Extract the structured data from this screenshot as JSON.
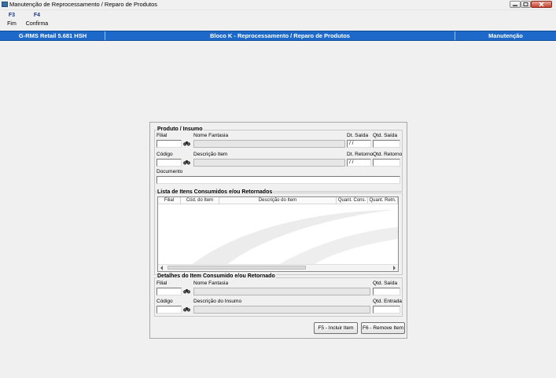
{
  "window": {
    "title": "Manutenção de Reprocessamento / Reparo de Produtos"
  },
  "toolbar": {
    "items": [
      {
        "key": "F3",
        "label": "Fim"
      },
      {
        "key": "F4",
        "label": "Confirma"
      }
    ]
  },
  "statusbar": {
    "app": "G-RMS Retail 5.681 HSH",
    "module": "Bloco K - Reprocessamento / Reparo de Produtos",
    "mode": "Manutenção",
    "color": "#1c69c9"
  },
  "produto_insumo": {
    "title": "Produto / Insumo",
    "filial_label": "Filial",
    "nome_fantasia_label": "Nome Fantasia",
    "dt_saida_label": "Dt. Saída",
    "dt_saida_value": " / /",
    "qtd_saida_label": "Qtd. Saída",
    "codigo_label": "Código",
    "descricao_item_label": "Descrição Item",
    "dt_retorno_label": "Dt. Retorno",
    "dt_retorno_value": " / /",
    "qtd_retorno_label": "Qtd. Retorno",
    "documento_label": "Documento"
  },
  "lista": {
    "title": "Lista de Itens Consumidos e/ou Retornados",
    "columns": [
      "Filial",
      "Cód. do Item",
      "Descrição do Item",
      "Quant. Cons.",
      "Quant. Retn."
    ]
  },
  "detalhes": {
    "title": "Detalhes do Item Consumido e/ou Retornado",
    "filial_label": "Filial",
    "nome_fantasia_label": "Nome Fantasia",
    "qtd_saida_label": "Qtd. Saída",
    "codigo_label": "Código",
    "descricao_insumo_label": "Descrição do Insumo",
    "qtd_entrada_label": "Qtd. Entrada"
  },
  "buttons": {
    "incluir": "F5 - Incluir Item",
    "remover": "F6 - Remove Item"
  },
  "icons": {
    "app": "app-icon",
    "search": "binoculars-icon"
  }
}
